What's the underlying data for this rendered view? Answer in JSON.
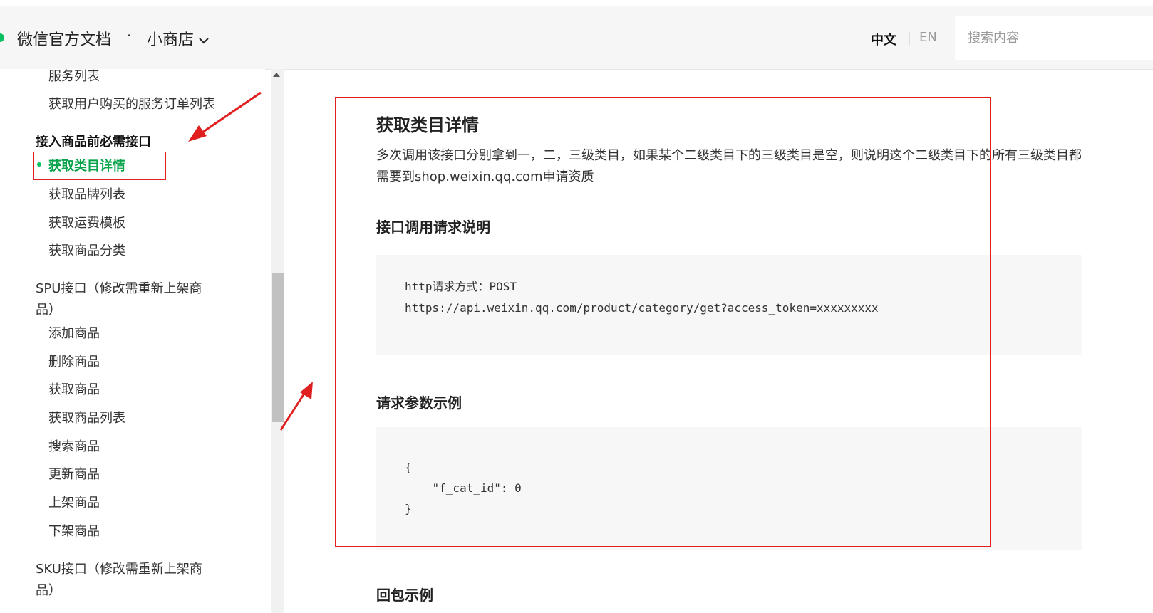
{
  "header": {
    "site_title": "微信官方文档",
    "separator": "·",
    "product": "小商店",
    "lang_cn": "中文",
    "lang_en": "EN",
    "search_placeholder": "搜索内容"
  },
  "sidebar": {
    "items": [
      {
        "label": "服务列表"
      },
      {
        "label": "获取用户购买的服务订单列表"
      },
      {
        "label": "接入商品前必需接口"
      },
      {
        "label": "获取类目详情",
        "active": true
      },
      {
        "label": "获取品牌列表"
      },
      {
        "label": "获取运费模板"
      },
      {
        "label": "获取商品分类"
      },
      {
        "label": "SPU接口（修改需重新上架商"
      },
      {
        "label": "品）"
      },
      {
        "label": "添加商品"
      },
      {
        "label": "删除商品"
      },
      {
        "label": "获取商品"
      },
      {
        "label": "获取商品列表"
      },
      {
        "label": "搜索商品"
      },
      {
        "label": "更新商品"
      },
      {
        "label": "上架商品"
      },
      {
        "label": "下架商品"
      },
      {
        "label": "SKU接口（修改需重新上架商"
      },
      {
        "label": "品）"
      }
    ]
  },
  "content": {
    "title": "获取类目详情",
    "description": "多次调用该接口分别拿到一，二，三级类目，如果某个二级类目下的三级类目是空，则说明这个二级类目下的所有三级类目都需要到shop.weixin.qq.com申请资质",
    "request_heading": "接口调用请求说明",
    "request_code": [
      "http请求方式：POST",
      "https://api.weixin.qq.com/product/category/get?access_token=xxxxxxxxx"
    ],
    "params_heading": "请求参数示例",
    "params_code": [
      "{",
      "    \"f_cat_id\": 0",
      "}"
    ],
    "response_heading": "回包示例"
  },
  "colors": {
    "accent": "#07c160",
    "annotation": "#e02020"
  }
}
